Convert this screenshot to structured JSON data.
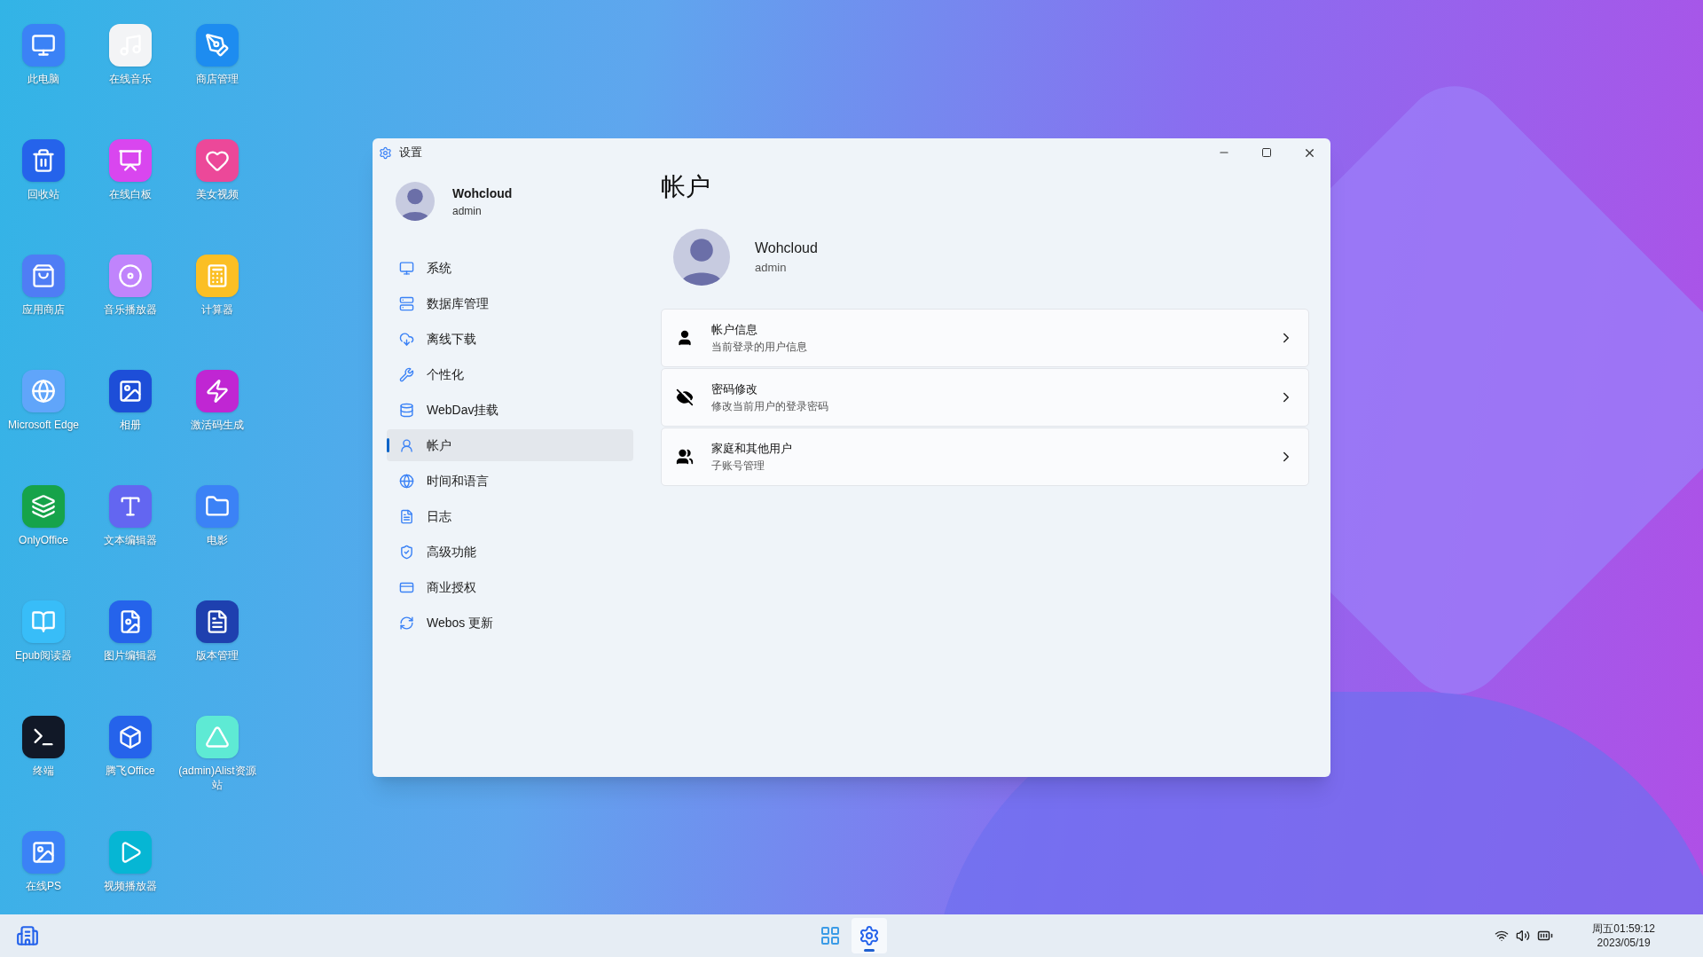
{
  "desktop": {
    "icons": [
      {
        "label": "此电脑"
      },
      {
        "label": "在线音乐"
      },
      {
        "label": "商店管理"
      },
      {
        "label": "回收站"
      },
      {
        "label": "在线白板"
      },
      {
        "label": "美女视频"
      },
      {
        "label": "应用商店"
      },
      {
        "label": "音乐播放器"
      },
      {
        "label": "计算器"
      },
      {
        "label": "Microsoft Edge"
      },
      {
        "label": "相册"
      },
      {
        "label": "激活码生成"
      },
      {
        "label": "OnlyOffice"
      },
      {
        "label": "文本编辑器"
      },
      {
        "label": "电影"
      },
      {
        "label": "Epub阅读器"
      },
      {
        "label": "图片编辑器"
      },
      {
        "label": "版本管理"
      },
      {
        "label": "终端"
      },
      {
        "label": "腾飞Office"
      },
      {
        "label": "(admin)Alist资源站"
      },
      {
        "label": "在线PS"
      },
      {
        "label": "视频播放器"
      }
    ]
  },
  "window": {
    "title": "设置",
    "profile": {
      "name": "Wohcloud",
      "role": "admin"
    },
    "nav": [
      {
        "label": "系统",
        "selected": false
      },
      {
        "label": "数据库管理",
        "selected": false
      },
      {
        "label": "离线下载",
        "selected": false
      },
      {
        "label": "个性化",
        "selected": false
      },
      {
        "label": "WebDav挂载",
        "selected": false
      },
      {
        "label": "帐户",
        "selected": true
      },
      {
        "label": "时间和语言",
        "selected": false
      },
      {
        "label": "日志",
        "selected": false
      },
      {
        "label": "高级功能",
        "selected": false
      },
      {
        "label": "商业授权",
        "selected": false
      },
      {
        "label": "Webos 更新",
        "selected": false
      }
    ],
    "page_title": "帐户",
    "account": {
      "name": "Wohcloud",
      "role": "admin"
    },
    "cards": [
      {
        "title": "帐户信息",
        "subtitle": "当前登录的用户信息"
      },
      {
        "title": "密码修改",
        "subtitle": "修改当前用户的登录密码"
      },
      {
        "title": "家庭和其他用户",
        "subtitle": "子账号管理"
      }
    ]
  },
  "taskbar": {
    "apps": [
      {
        "selected": false
      },
      {
        "selected": true
      }
    ],
    "clock": {
      "day_time": "周五01:59:12",
      "date": "2023/05/19"
    }
  }
}
